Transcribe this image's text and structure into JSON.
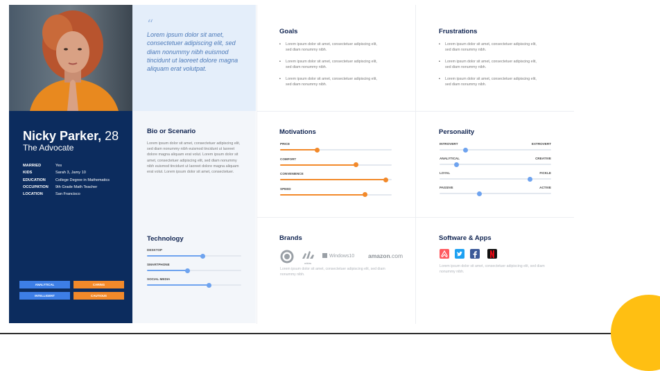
{
  "persona": {
    "first_name": "Nicky Parker,",
    "age": "28",
    "role": "The Advocate",
    "facts": [
      {
        "key": "MARRIED",
        "value": "Yes"
      },
      {
        "key": "KIDS",
        "value": "Sarah 3, Jamy 10"
      },
      {
        "key": "EDUCATION",
        "value": "College Degree in Mathematics"
      },
      {
        "key": "OCCUPATION",
        "value": "9th Grade Math Teacher"
      },
      {
        "key": "LOCATION",
        "value": "San Francisco"
      }
    ],
    "tags": [
      {
        "label": "ANALYTICAL",
        "color": "#3d7ee6"
      },
      {
        "label": "CARING",
        "color": "#f2892a"
      },
      {
        "label": "INTELLIGENT",
        "color": "#3d7ee6"
      },
      {
        "label": "CAUTIOUS",
        "color": "#f2892a"
      }
    ]
  },
  "quote": {
    "mark": "“",
    "text": "Lorem ipsum dolor sit amet, consectetuer adipiscing elit, sed diam nonummy nibh euismod tincidunt ut laoreet dolore magna aliquam erat volutpat."
  },
  "goals": {
    "title": "Goals",
    "items": [
      "Lorem ipsum dolor sit amet, consectetuer adipiscing elit, sed diam nonummy nibh.",
      "Lorem ipsum dolor sit amet, consectetuer adipiscing elit, sed diam nonummy nibh.",
      "Lorem ipsum dolor sit amet, consectetuer adipiscing elit, sed diam nonummy nibh."
    ]
  },
  "frustrations": {
    "title": "Frustrations",
    "items": [
      "Lorem ipsum dolor sit amet, consectetuer adipiscing elit, sed diam nonummy nibh.",
      "Lorem ipsum dolor sit amet, consectetuer adipiscing elit, sed diam nonummy nibh.",
      "Lorem ipsum dolor sit amet, consectetuer adipiscing elit, sed diam nonummy nibh."
    ]
  },
  "bio": {
    "title": "Bio or Scenario",
    "text": "Lorem ipsum dolor sit amet, consectetuer adipiscing elit, sed diam nonummy nibh euismod tincidunt ut laoreet dolore magna aliquam erat volut. Lorem ipsum dolor sit amet, consectetuer adipiscing elit, sed diam nonummy nibh euismod tincidunt ut laoreet dolore magna aliquam erat volut. Lorem ipsum dolor sit amet, consectetuer."
  },
  "motivations": {
    "title": "Motivations",
    "color": "#f2892a",
    "items": [
      {
        "label": "PRICE",
        "value": 0.33
      },
      {
        "label": "COMFORT",
        "value": 0.68
      },
      {
        "label": "CONVENIENCE",
        "value": 0.95
      },
      {
        "label": "SPEED",
        "value": 0.76
      }
    ]
  },
  "personality": {
    "title": "Personality",
    "color": "#6ea3ef",
    "items": [
      {
        "left": "INTROVERT",
        "right": "EXTROVERT",
        "value": 0.23
      },
      {
        "left": "ANALYTICAL",
        "right": "CREATIVE",
        "value": 0.15
      },
      {
        "left": "LOYAL",
        "right": "FICKLE",
        "value": 0.81
      },
      {
        "left": "PASSIVE",
        "right": "ACTIVE",
        "value": 0.36
      }
    ]
  },
  "technology": {
    "title": "Technology",
    "color": "#6ea3ef",
    "items": [
      {
        "label": "DESKTOP",
        "value": 0.59
      },
      {
        "label": "SMARTPHONE",
        "value": 0.43
      },
      {
        "label": "SOCIAL MEDIA",
        "value": 0.66
      }
    ]
  },
  "brands": {
    "title": "Brands",
    "logos": [
      "starbucks-icon",
      "adidas-icon",
      "Windows10",
      "amazon.com"
    ],
    "adidas_text": "adidas",
    "windows_text": "Windows10",
    "amazon_text": "amazon",
    "amazon_suffix": "com",
    "text": "Lorem ipsum dolor sit amet, consectetuer adipiscing elit, sed diam nonummy nibh."
  },
  "software": {
    "title": "Software & Apps",
    "apps": [
      {
        "icon": "airbnb-icon",
        "color": "#ff5a5f"
      },
      {
        "icon": "twitter-icon",
        "color": "#1da1f2"
      },
      {
        "icon": "facebook-icon",
        "color": "#3b5998"
      },
      {
        "icon": "netflix-icon",
        "color": "#111111"
      }
    ],
    "text": "Lorem ipsum dolor sit amet, consectetuer adipiscing elit, sed diam nonummy nibh."
  }
}
